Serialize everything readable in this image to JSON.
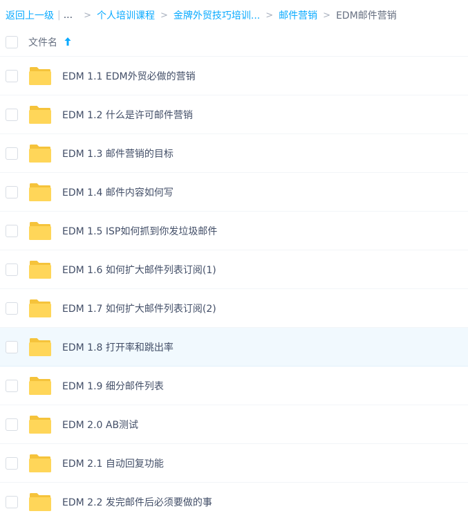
{
  "breadcrumb": {
    "back": "返回上一级",
    "ellipsis": "...",
    "items": [
      "个人培训课程",
      "金牌外贸技巧培训...",
      "邮件营销"
    ],
    "current": "EDM邮件营销"
  },
  "header": {
    "column_label": "文件名",
    "sort_icon": "arrow-up-icon"
  },
  "files": [
    {
      "name": "EDM 1.1 EDM外贸必做的营销",
      "type": "folder"
    },
    {
      "name": "EDM 1.2 什么是许可邮件营销",
      "type": "folder"
    },
    {
      "name": "EDM 1.3 邮件营销的目标",
      "type": "folder"
    },
    {
      "name": "EDM 1.4 邮件内容如何写",
      "type": "folder"
    },
    {
      "name": "EDM 1.5 ISP如何抓到你发垃圾邮件",
      "type": "folder"
    },
    {
      "name": "EDM 1.6 如何扩大邮件列表订阅(1)",
      "type": "folder"
    },
    {
      "name": "EDM 1.7 如何扩大邮件列表订阅(2)",
      "type": "folder"
    },
    {
      "name": "EDM 1.8 打开率和跳出率",
      "type": "folder",
      "highlighted": true
    },
    {
      "name": "EDM 1.9 细分邮件列表",
      "type": "folder"
    },
    {
      "name": "EDM 2.0 AB测试",
      "type": "folder"
    },
    {
      "name": "EDM 2.1 自动回复功能",
      "type": "folder"
    },
    {
      "name": "EDM 2.2 发完邮件后必须要做的事",
      "type": "folder"
    }
  ],
  "colors": {
    "link": "#09aaff",
    "folder": "#ffd659",
    "highlight_row": "#f1f9fe"
  }
}
